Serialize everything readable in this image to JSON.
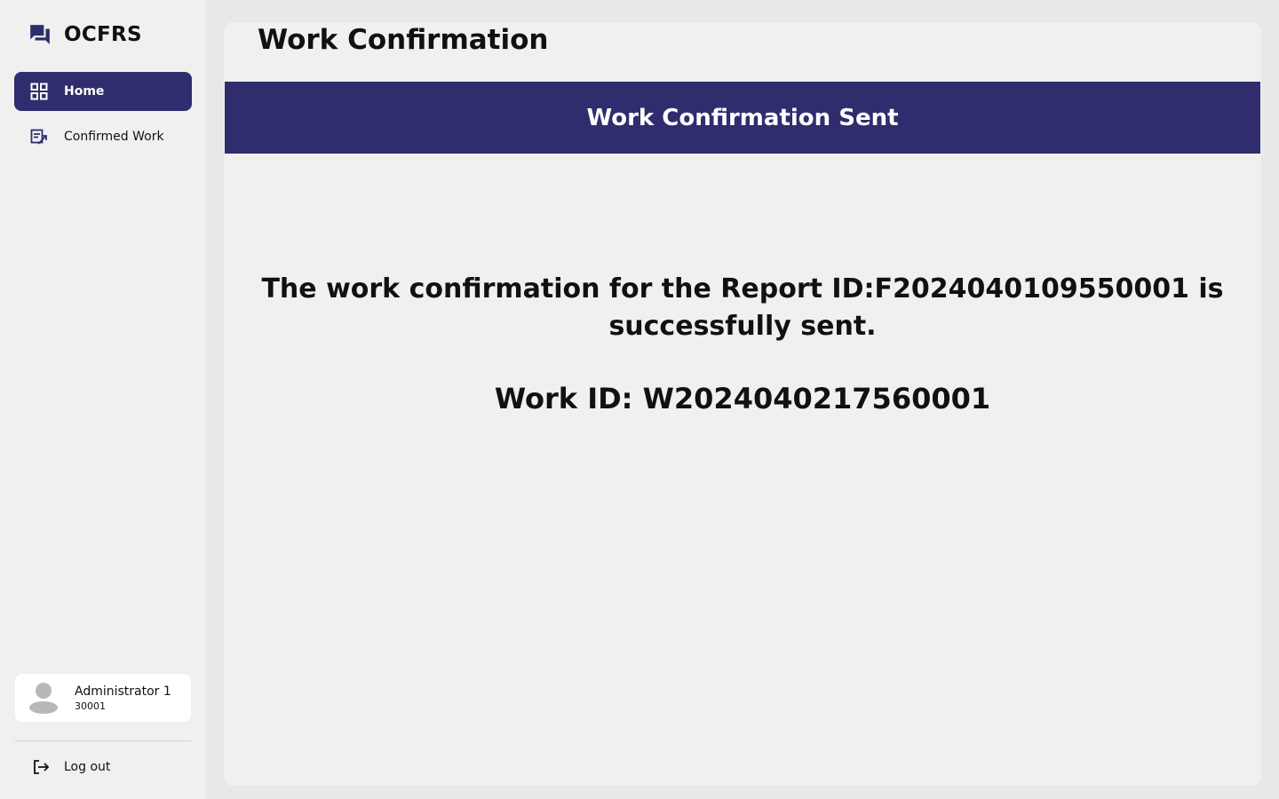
{
  "app": {
    "name": "OCFRS"
  },
  "sidebar": {
    "items": [
      {
        "label": "Home",
        "icon": "grid-icon",
        "active": true
      },
      {
        "label": "Confirmed Work",
        "icon": "confirmed-work-icon",
        "active": false
      }
    ],
    "user": {
      "name": "Administrator 1",
      "id": "30001"
    },
    "logout_label": "Log out"
  },
  "main": {
    "title": "Work Confirmation",
    "banner": "Work Confirmation Sent",
    "message": "The work confirmation for the Report ID:F2024040109550001 is successfully sent.",
    "work_id": "Work ID: W2024040217560001"
  },
  "colors": {
    "primary": "#2f2d6d",
    "sidebar_bg": "#f0f0f0",
    "page_bg": "#e8e8e8"
  }
}
